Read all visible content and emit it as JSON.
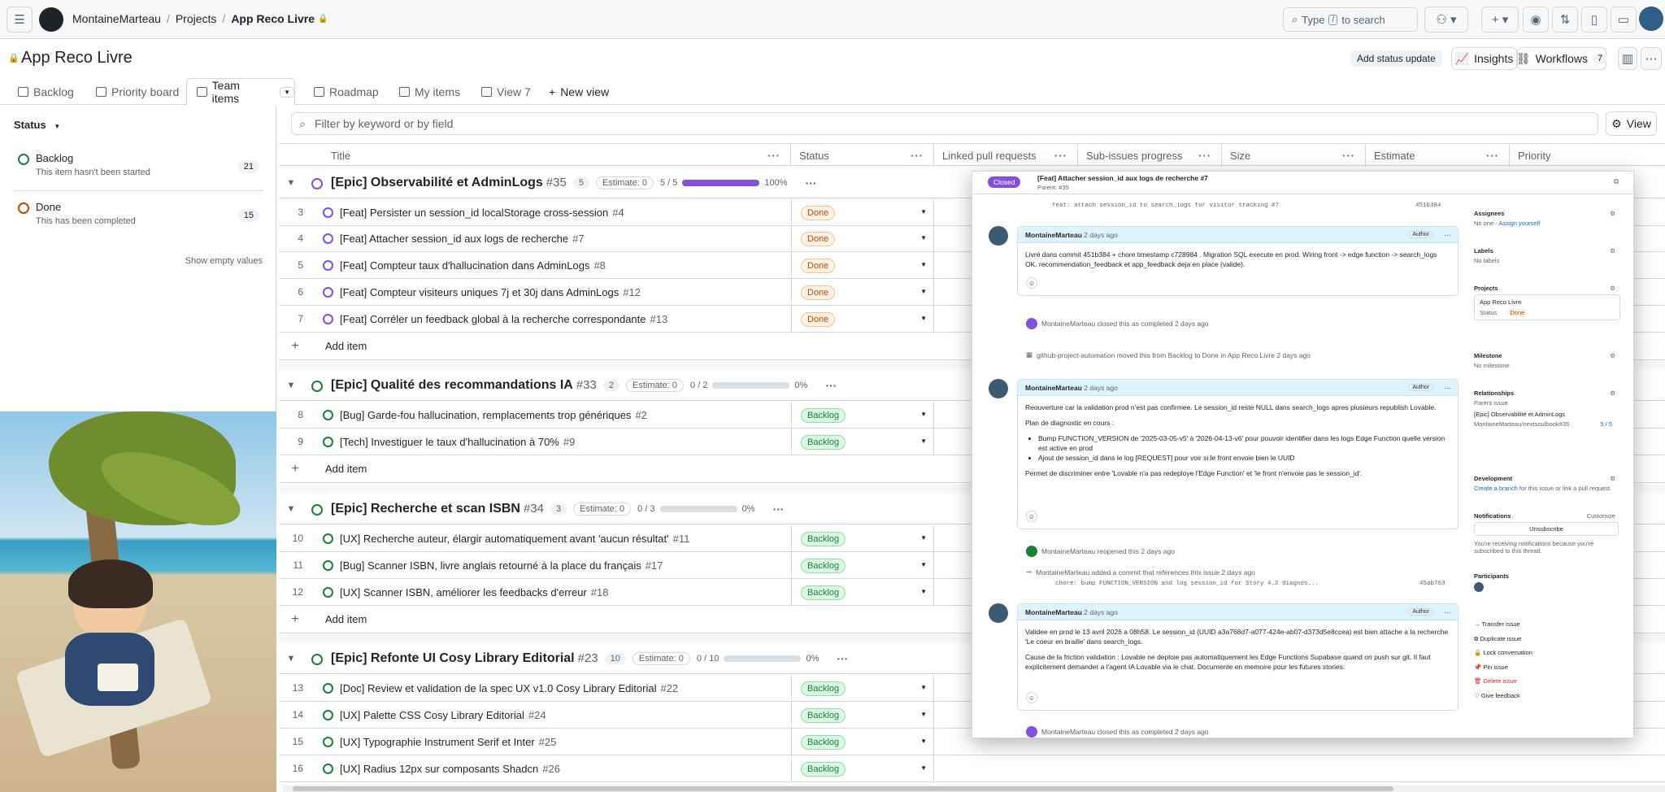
{
  "header": {
    "owner": "MontaineMarteau",
    "projects": "Projects",
    "project": "App Reco Livre",
    "search_type": "Type",
    "search_key": "/",
    "search_tail": "to search"
  },
  "project_header": {
    "title": "App Reco Livre",
    "add_status": "Add status update",
    "insights": "Insights",
    "workflows": "Workflows",
    "workflows_count": "7"
  },
  "tabs": [
    "Backlog",
    "Priority board",
    "Team items",
    "Roadmap",
    "My items",
    "View 7"
  ],
  "new_view": "New view",
  "sidebar": {
    "heading": "Status",
    "groups": [
      {
        "name": "Backlog",
        "desc": "This item hasn't been started",
        "count": "21"
      },
      {
        "name": "Done",
        "desc": "This has been completed",
        "count": "15"
      }
    ],
    "show_empty": "Show empty values"
  },
  "filter": {
    "placeholder": "Filter by keyword or by field",
    "view_label": "View"
  },
  "columns": [
    "Title",
    "Status",
    "Linked pull requests",
    "Sub-issues progress",
    "Size",
    "Estimate",
    "Priority"
  ],
  "epics": [
    {
      "title": "[Epic] Observabilité et AdminLogs",
      "num": "#35",
      "count": "5",
      "estimate": "Estimate: 0",
      "progress": "5 / 5",
      "pct": "100%",
      "fill": 1.0,
      "done": true,
      "items": [
        {
          "n": "3",
          "t": "[Feat] Persister un session_id localStorage cross-session",
          "id": "#4",
          "s": "Done"
        },
        {
          "n": "4",
          "t": "[Feat] Attacher session_id aux logs de recherche",
          "id": "#7",
          "s": "Done"
        },
        {
          "n": "5",
          "t": "[Feat] Compteur taux d'hallucination dans AdminLogs",
          "id": "#8",
          "s": "Done"
        },
        {
          "n": "6",
          "t": "[Feat] Compteur visiteurs uniques 7j et 30j dans AdminLogs",
          "id": "#12",
          "s": "Done"
        },
        {
          "n": "7",
          "t": "[Feat] Corréler un feedback global à la recherche correspondante",
          "id": "#13",
          "s": "Done"
        }
      ]
    },
    {
      "title": "[Epic] Qualité des recommandations IA",
      "num": "#33",
      "count": "2",
      "estimate": "Estimate: 0",
      "progress": "0 / 2",
      "pct": "0%",
      "fill": 0,
      "done": false,
      "items": [
        {
          "n": "8",
          "t": "[Bug] Garde-fou hallucination, remplacements trop génériques",
          "id": "#2",
          "s": "Backlog"
        },
        {
          "n": "9",
          "t": "[Tech] Investiguer le taux d'hallucination à 70%",
          "id": "#9",
          "s": "Backlog"
        }
      ]
    },
    {
      "title": "[Epic] Recherche et scan ISBN",
      "num": "#34",
      "count": "3",
      "estimate": "Estimate: 0",
      "progress": "0 / 3",
      "pct": "0%",
      "fill": 0,
      "done": false,
      "items": [
        {
          "n": "10",
          "t": "[UX] Recherche auteur, élargir automatiquement avant 'aucun résultat'",
          "id": "#11",
          "s": "Backlog"
        },
        {
          "n": "11",
          "t": "[Bug] Scanner ISBN, livre anglais retourné à la place du français",
          "id": "#17",
          "s": "Backlog"
        },
        {
          "n": "12",
          "t": "[UX] Scanner ISBN, améliorer les feedbacks d'erreur",
          "id": "#18",
          "s": "Backlog"
        }
      ]
    },
    {
      "title": "[Epic] Refonte UI Cosy Library Editorial",
      "num": "#23",
      "count": "10",
      "estimate": "Estimate: 0",
      "progress": "0 / 10",
      "pct": "0%",
      "fill": 0,
      "done": false,
      "items": [
        {
          "n": "13",
          "t": "[Doc] Review et validation de la spec UX v1.0 Cosy Library Editorial",
          "id": "#22",
          "s": "Backlog"
        },
        {
          "n": "14",
          "t": "[UX] Palette CSS Cosy Library Editorial",
          "id": "#24",
          "s": "Backlog"
        },
        {
          "n": "15",
          "t": "[UX] Typographie Instrument Serif et Inter",
          "id": "#25",
          "s": "Backlog"
        },
        {
          "n": "16",
          "t": "[UX] Radius 12px sur composants Shadcn",
          "id": "#26",
          "s": "Backlog"
        }
      ]
    }
  ],
  "add_item": "Add item",
  "overlay": {
    "state": "Closed",
    "title": "[Feat] Attacher session_id aux logs de recherche #7",
    "parent": "Parent: #35",
    "commit_line": "feat: attach session_id to search_logs for visitor tracking #7",
    "commit_sha": "451b384",
    "c1": {
      "author": "MontaineMarteau",
      "time": "2 days ago",
      "role": "Author",
      "body": "Livré dans commit 451b384 + chore timestamp c728984 . Migration SQL execute en prod. Wiring front -> edge function -> search_logs OK. recommendation_feedback et app_feedback deja en place (valide)."
    },
    "e1": "MontaineMarteau closed this as completed 2 days ago",
    "e2": "github-project-automation moved this from Backlog to Done in App Reco Livre 2 days ago",
    "c2": {
      "author": "MontaineMarteau",
      "time": "2 days ago",
      "role": "Author",
      "p1": "Reouverture car la validation prod n'est pas confirmee. Le session_id reste NULL dans search_logs apres plusieurs republish Lovable.",
      "p2": "Plan de diagnostic en cours :",
      "li1": "Bump FUNCTION_VERSION de '2025-03-05-v5' à '2026-04-13-v6' pour pouvoir identifier dans les logs Edge Function quelle version est active en prod",
      "li2": "Ajout de session_id dans le log [REQUEST] pour voir si le front envoie bien le UUID",
      "p3": "Permet de discriminer entre 'Lovable n'a pas redeploye l'Edge Function' et 'le front n'envoie pas le session_id'."
    },
    "e3": "MontaineMarteau reopened this 2 days ago",
    "e4": "MontaineMarteau added a commit that references this issue 2 days ago",
    "commit2": "chore: bump FUNCTION_VERSION and log session_id for Story 4.2 diagnos...",
    "commit2_sha": "45ab763",
    "c3": {
      "author": "MontaineMarteau",
      "time": "2 days ago",
      "role": "Author",
      "p1": "Validee en prod le 13 avril 2026 a 08h58. Le session_id (UUID a3a768d7-a077-424e-ab07-d373d5e8ccea) est bien attache a la recherche 'Le coeur en braille' dans search_logs.",
      "p2": "Cause de la friction validation : Lovable ne deploie pas automatiquement les Edge Functions Supabase quand on push sur git. Il faut explicitement demander a l'agent IA Lovable via le chat. Documente en memoire pour les futures stories."
    },
    "e5": "MontaineMarteau closed this as completed 2 days ago",
    "side": {
      "assignees": "Assignees",
      "assign_none": "No one -",
      "assign_self": "Assign yourself",
      "labels": "Labels",
      "no_labels": "No labels",
      "projects": "Projects",
      "proj_name": "App Reco Livre",
      "proj_status": "Status",
      "proj_status_val": "Done",
      "milestone": "Milestone",
      "no_milestone": "No milestone",
      "relationships": "Relationships",
      "parent_issue": "Parent issue",
      "parent_title": "[Epic] Observabilité et AdminLogs",
      "parent_repo": "MontaineMarteau/nextsoulbook#35",
      "parent_prog": "5 / 5",
      "development": "Development",
      "dev_link": "Create a branch",
      "dev_rest": "for this issue or link a pull request.",
      "notifications": "Notifications",
      "customize": "Customize",
      "unsubscribe": "Unsubscribe",
      "notif_text": "You're receiving notifications because you're subscribed to this thread.",
      "participants": "Participants",
      "actions": [
        "Transfer issue",
        "Duplicate issue",
        "Lock conversation",
        "Pin issue",
        "Delete issue",
        "Give feedback"
      ]
    }
  }
}
